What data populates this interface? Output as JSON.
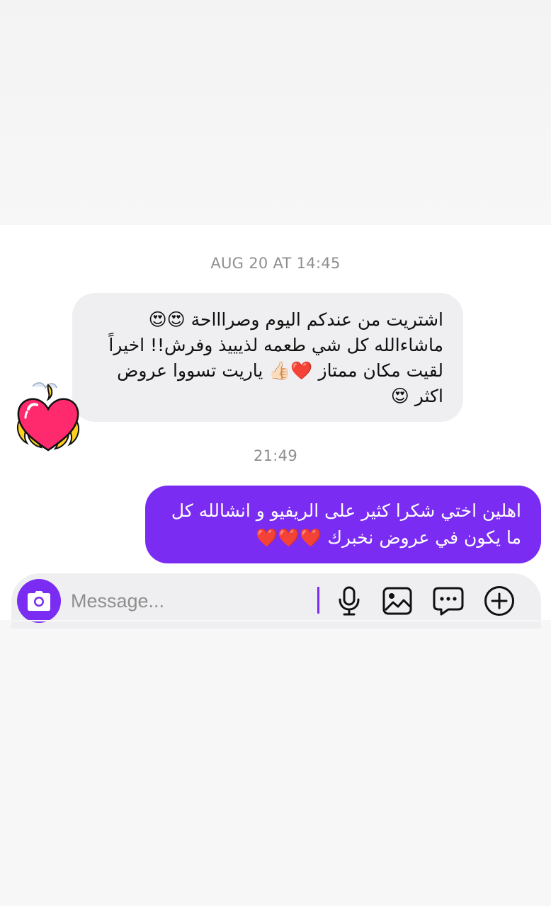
{
  "thread": {
    "messages": [
      {
        "timestamp": "AUG 20 AT 14:45",
        "direction": "incoming",
        "text": "اشتريت من عندكم اليوم وصراااحة 😍😍\nماشاءالله كل شي طعمه لذيييذ وفرش!! اخيراً\nلقيت مكان ممتاز ❤️👍🏻 ياريت تسووا عروض\nاكثر 😍"
      },
      {
        "timestamp": "21:49",
        "direction": "outgoing",
        "text": "اهلين اختي شكرا كثير على الريفيو و انشالله كل\nما يكون في عروض نخبرك ❤️❤️❤️"
      }
    ]
  },
  "composer": {
    "placeholder": "Message...",
    "value": "",
    "icons": [
      "camera-icon",
      "microphone-icon",
      "gallery-icon",
      "sticker-icon",
      "plus-icon"
    ]
  },
  "colors": {
    "accent": "#7a2cf2",
    "incoming_bubble": "#efeff1",
    "timestamp": "#8e8e8e"
  }
}
